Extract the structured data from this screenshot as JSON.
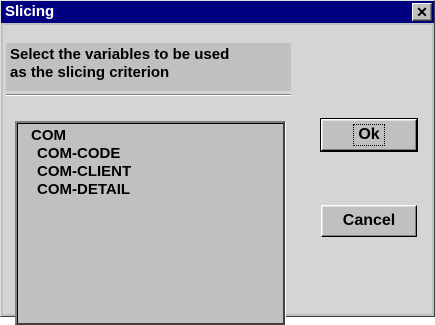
{
  "window": {
    "title": "Slicing",
    "close_glyph": "✕"
  },
  "prompt": {
    "line1": "Select the variables to be used",
    "line2": "as the slicing criterion"
  },
  "list": {
    "items": [
      "COM",
      "COM-CODE",
      "COM-CLIENT",
      "COM-DETAIL"
    ]
  },
  "buttons": {
    "ok_label": "Ok",
    "cancel_label": "Cancel"
  },
  "colors": {
    "title_bar": "#000080",
    "face": "#c0c0c0"
  },
  "icons": [
    "close-icon"
  ]
}
